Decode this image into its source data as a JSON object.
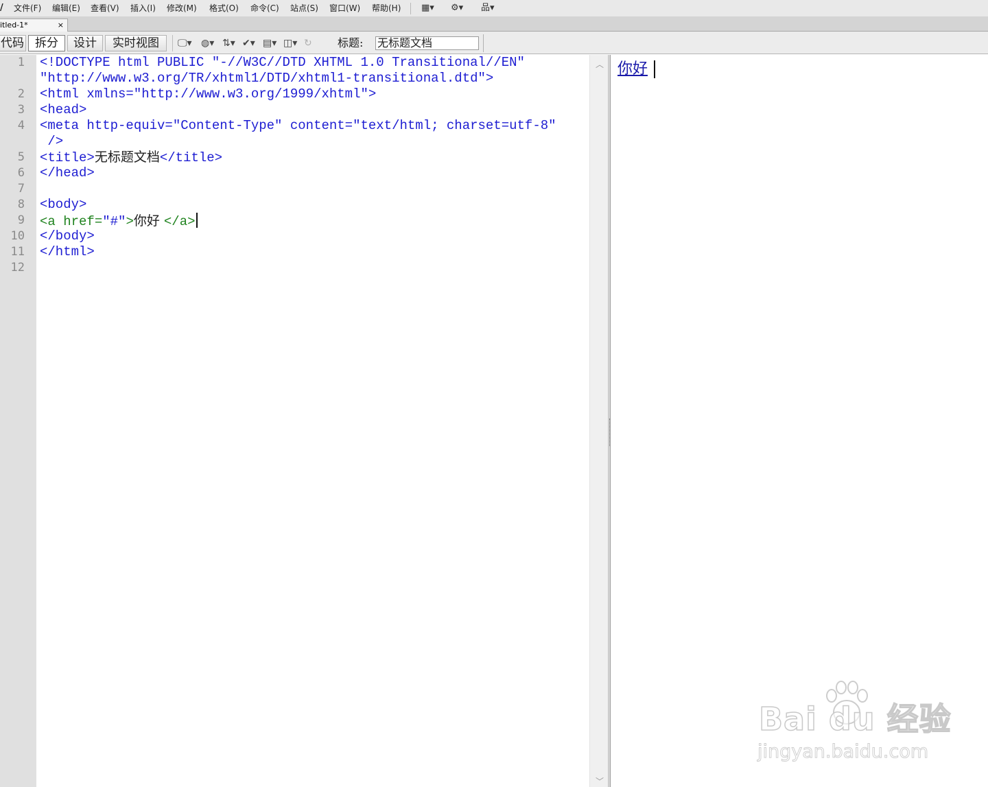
{
  "menubar": {
    "logo": "/",
    "items": [
      "文件(F)",
      "编辑(E)",
      "查看(V)",
      "插入(I)",
      "修改(M)",
      "格式(O)",
      "命令(C)",
      "站点(S)",
      "窗口(W)",
      "帮助(H)"
    ],
    "layout_icon": "▦▾",
    "gear_icon": "⚙▾",
    "site_icon": "品▾"
  },
  "tab": {
    "name": "itled-1*",
    "close": "×"
  },
  "doc_toolbar": {
    "views": [
      "代码",
      "拆分",
      "设计",
      "实时视图"
    ],
    "title_label": "标题:",
    "title_value": "无标题文档",
    "icons": {
      "multiscreen": "🖵▾",
      "preview": "◍▾",
      "file_mgmt": "⇅▾",
      "validate": "✔▾",
      "visual_aids": "▤▾",
      "view_options": "◫▾",
      "refresh": "↻"
    }
  },
  "code": {
    "line_numbers": [
      "1",
      "",
      "2",
      "3",
      "4",
      "",
      "5",
      "6",
      "7",
      "8",
      "9",
      "10",
      "11",
      "12"
    ],
    "l1": "<!DOCTYPE html PUBLIC \"-//W3C//DTD XHTML 1.0 Transitional//EN\"",
    "l1b": "\"http://www.w3.org/TR/xhtml1/DTD/xhtml1-transitional.dtd\">",
    "l2": "<html xmlns=\"http://www.w3.org/1999/xhtml\">",
    "l3": "<head>",
    "l4": "<meta http-equiv=\"Content-Type\" content=\"text/html; charset=utf-8\"",
    "l4b": " />",
    "l5_open": "<title>",
    "l5_text": "无标题文档",
    "l5_close": "</title>",
    "l6": "</head>",
    "l8": "<body>",
    "l9_open": "<a href=",
    "l9_val": "\"#\"",
    "l9_gt": ">",
    "l9_text": "你好 ",
    "l9_close": "</a>",
    "l10": "</body>",
    "l11": "</html>"
  },
  "scroll": {
    "up": "︿",
    "down": "﹀"
  },
  "design": {
    "link_text": "你好"
  },
  "watermark": {
    "brand": "Bai du 经验",
    "url": "jingyan.baidu.com"
  }
}
